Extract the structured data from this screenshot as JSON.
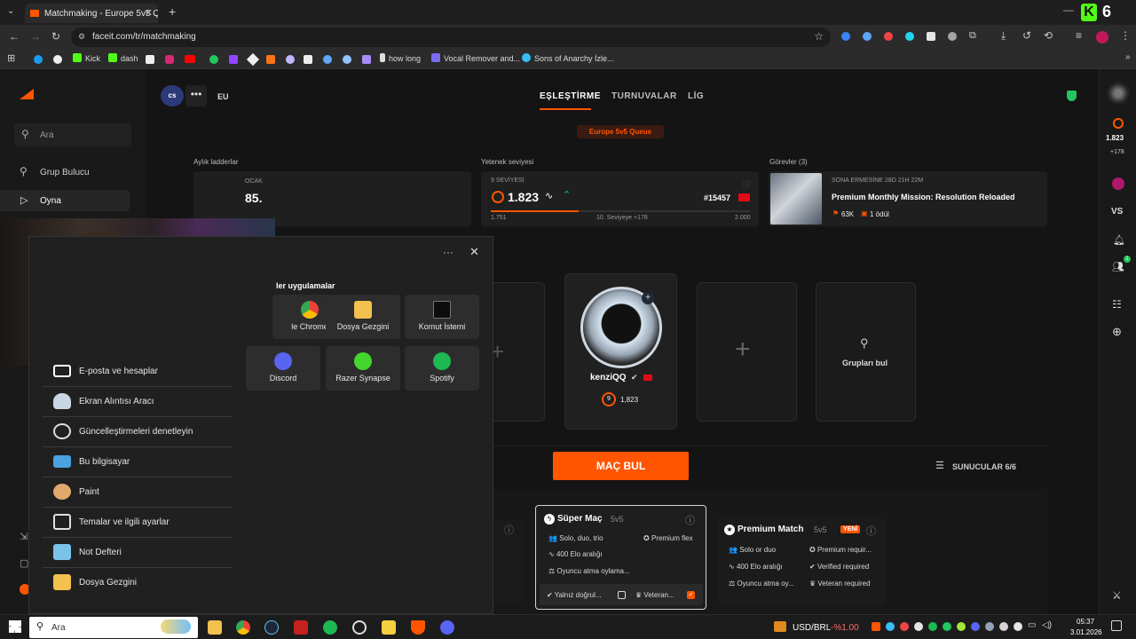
{
  "browser": {
    "tab_title": "Matchmaking - Europe 5v5 Qu",
    "url": "faceit.com/tr/matchmaking",
    "bookmarks": [
      {
        "label": "Kick"
      },
      {
        "label": "dash"
      },
      {
        "label": "how long"
      },
      {
        "label": "Vocal Remover and..."
      },
      {
        "label": "Sons of Anarchy İzle..."
      }
    ]
  },
  "overlay_badge": {
    "text": "6"
  },
  "sidebar": {
    "search_placeholder": "Ara",
    "items": [
      {
        "label": "Grup Bulucu"
      },
      {
        "label": "Oyna"
      }
    ]
  },
  "header": {
    "game_logo": "cs",
    "region": "EU",
    "tabs": [
      {
        "label": "EŞLEŞTİRME",
        "active": true
      },
      {
        "label": "TURNUVALAR",
        "active": false
      },
      {
        "label": "LİG",
        "active": false
      }
    ],
    "queue_badge": "Europe 5v5 Queue"
  },
  "ladders": {
    "title": "Aylık ladderlar",
    "month": "OCAK",
    "value": "85."
  },
  "skill": {
    "title": "Yetenek seviyesi",
    "level_label": "9 SEVİYESİ",
    "elo": "1.823",
    "rank": "#15457",
    "min": "1.751",
    "next": "10. Seviyeye +178",
    "max": "2.000",
    "progress": 0.34
  },
  "missions": {
    "title": "Görevler (3)",
    "ends": "SONA ERMESİNE 28D 21H 22M",
    "name": "Premium Monthly Mission: Resolution Reloaded",
    "points": "63K",
    "rewards": "1 ödül"
  },
  "party": {
    "player_name": "kenziQQ",
    "player_level": "9",
    "player_elo": "1,823",
    "find_groups": "Grupları bul"
  },
  "find_match": {
    "button": "MAÇ BUL",
    "servers": "SUNUCULAR 6/6"
  },
  "queues": {
    "super": {
      "title": "Süper Maç",
      "mode": "5v5",
      "rows": [
        "Solo, duo, trio",
        "400 Elo aralığı",
        "Oyuncu atma oylama..."
      ],
      "right": "Premium flex",
      "foot_left": "Yalnız doğrul...",
      "foot_right": "Veteran..."
    },
    "premium": {
      "title": "Premium Match",
      "mode": "5v5",
      "new_badge": "YENİ",
      "rows": [
        "Solo or duo",
        "400 Elo aralığı",
        "Oyuncu atma oy..."
      ],
      "right": [
        "Premium requir...",
        "Verified required",
        "Veteran required"
      ]
    }
  },
  "rightrail": {
    "elo": "1.823",
    "delta": "+178",
    "vs": "VS",
    "friends_count": "1"
  },
  "startmenu": {
    "section": "ler uygulamalar",
    "pinned": [
      {
        "label": "le Chrome",
        "color": "#e8453c"
      },
      {
        "label": "Dosya Gezgini",
        "color": "#f2c14e"
      },
      {
        "label": "Komut İstemi",
        "color": "#0c0c0c"
      },
      {
        "label": "Discord",
        "color": "#5865f2"
      },
      {
        "label": "Razer Synapse",
        "color": "#44d62c"
      },
      {
        "label": "Spotify",
        "color": "#1db954"
      }
    ],
    "list": [
      {
        "label": "E-posta ve hesaplar",
        "color": "#ffffff"
      },
      {
        "label": "Ekran Alıntısı Aracı",
        "color": "#c9d7e4"
      },
      {
        "label": "Güncelleştirmeleri denetleyin",
        "color": "#dcdcdc"
      },
      {
        "label": "Bu bilgisayar",
        "color": "#4aa3df"
      },
      {
        "label": "Paint",
        "color": "#e0a86a"
      },
      {
        "label": "Temalar ve ilgili ayarlar",
        "color": "#e0e0e0"
      },
      {
        "label": "Not Defteri",
        "color": "#7ac3e8"
      },
      {
        "label": "Dosya Gezgini",
        "color": "#f2c14e"
      }
    ]
  },
  "taskbar": {
    "search_placeholder": "Ara",
    "ticker_label": "USD/BRL",
    "ticker_value": "-%1.00",
    "time": "05:37",
    "date": "3.01.2026"
  }
}
